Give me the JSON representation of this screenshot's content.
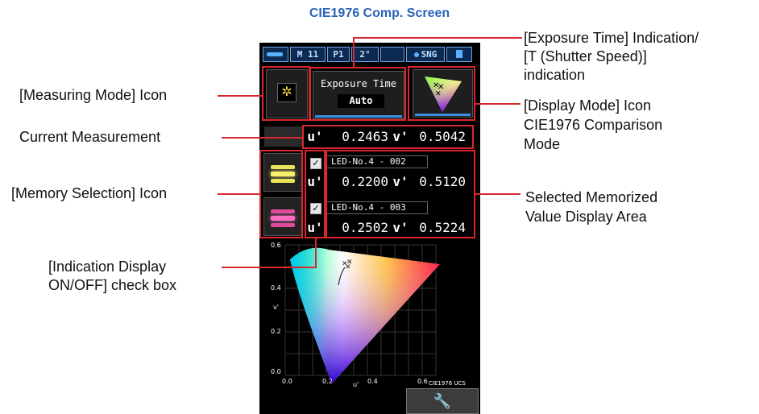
{
  "title": "CIE1976 Comp. Screen",
  "status_bar": {
    "mode": "M 11",
    "page": "P1",
    "angle": "2°",
    "sng": "SNG"
  },
  "exposure": {
    "label": "Exposure Time",
    "value": "Auto"
  },
  "current": {
    "u_label": "u'",
    "u_value": "0.2463",
    "v_label": "v'",
    "v_value": "0.5042"
  },
  "memories": [
    {
      "name": "LED-No.4 - 002",
      "u_label": "u'",
      "u_value": "0.2200",
      "v_label": "v'",
      "v_value": "0.5120",
      "checked": "✓"
    },
    {
      "name": "LED-No.4 - 003",
      "u_label": "u'",
      "u_value": "0.2502",
      "v_label": "v'",
      "v_value": "0.5224",
      "checked": "✓"
    }
  ],
  "chart": {
    "y_ticks": [
      "0.6",
      "0.4",
      "0.2",
      "0.0"
    ],
    "x_ticks": [
      "0.0",
      "0.2",
      "0.4",
      "0.6"
    ],
    "y_axis_label": "v'",
    "x_axis_label": "u'",
    "caption": "CIE1976 UCS"
  },
  "annotations": {
    "measuring_mode": "[Measuring Mode] Icon",
    "current_measurement": "Current Measurement",
    "memory_selection": "[Memory Selection] Icon",
    "indication_1": "[Indication Display",
    "indication_2": "ON/OFF] check box",
    "exposure_1": "[Exposure Time] Indication/",
    "exposure_2": "[T (Shutter Speed)]",
    "exposure_3": "indication",
    "display_1": "[Display Mode] Icon",
    "display_2": "CIE1976 Comparison",
    "display_3": "Mode",
    "selected_1": "Selected Memorized",
    "selected_2": "Value Display Area"
  },
  "colors": {
    "accent_red": "#d8282e",
    "title_blue": "#2a63b8",
    "screen_bg": "#000000"
  }
}
